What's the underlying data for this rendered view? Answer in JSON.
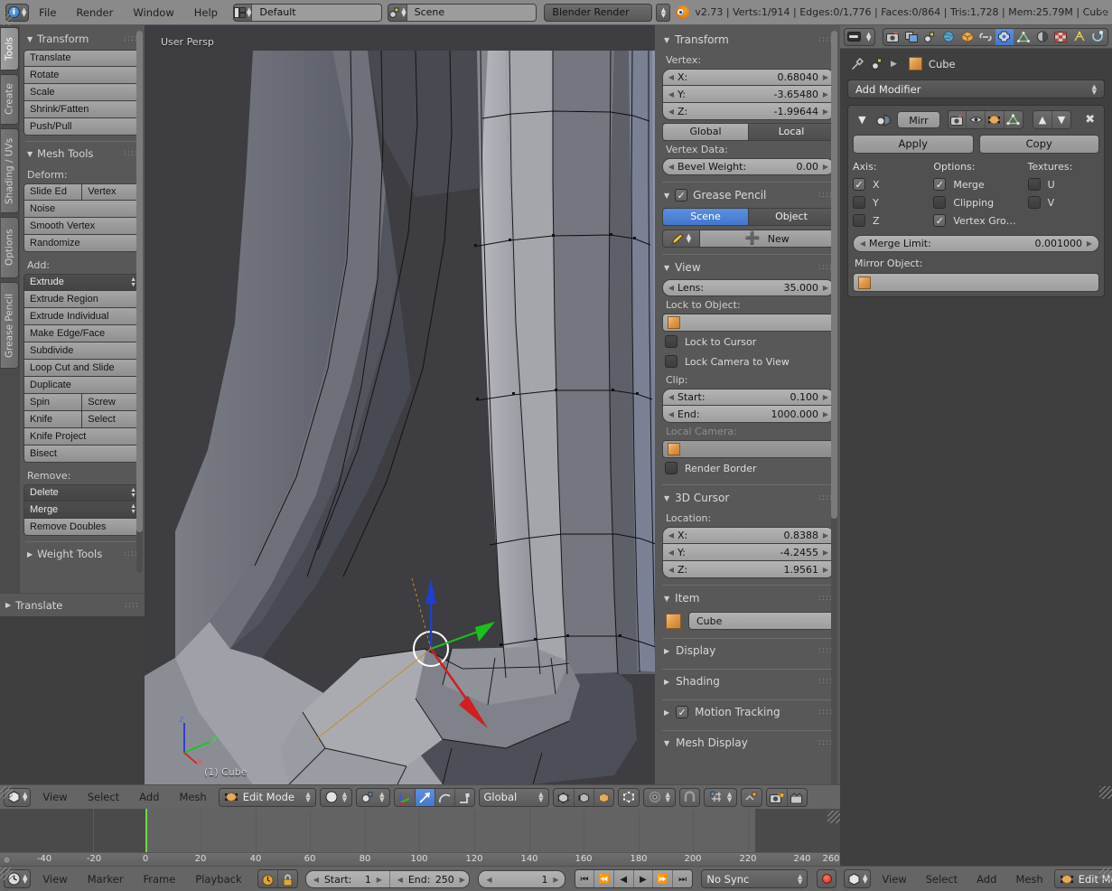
{
  "topbar": {
    "menus": [
      "File",
      "Render",
      "Window",
      "Help"
    ],
    "layout_value": "Default",
    "scene_value": "Scene",
    "engine_value": "Blender Render",
    "stats": "v2.73 | Verts:1/914 | Edges:0/1,776 | Faces:0/864 | Tris:1,728 | Mem:25.79M | Cube",
    "plus_label": "+",
    "x_label": "✕"
  },
  "left_tabs": [
    "Tools",
    "Create",
    "Shading / UVs",
    "Options",
    "Grease Pencil"
  ],
  "toolshelf": {
    "transform_title": "Transform",
    "transform_buttons": [
      "Translate",
      "Rotate",
      "Scale",
      "Shrink/Fatten",
      "Push/Pull"
    ],
    "meshtools_title": "Mesh Tools",
    "deform_label": "Deform:",
    "deform_pair": [
      "Slide Ed",
      "Vertex"
    ],
    "deform_rest": [
      "Noise",
      "Smooth Vertex",
      "Randomize"
    ],
    "add_label": "Add:",
    "add_dropdown": "Extrude",
    "add_buttons": [
      "Extrude Region",
      "Extrude Individual",
      "Make Edge/Face",
      "Subdivide",
      "Loop Cut and Slide",
      "Duplicate"
    ],
    "add_pair1": [
      "Spin",
      "Screw"
    ],
    "add_pair2": [
      "Knife",
      "Select"
    ],
    "add_buttons2": [
      "Knife Project",
      "Bisect"
    ],
    "remove_label": "Remove:",
    "remove_dropdowns": [
      "Delete",
      "Merge"
    ],
    "remove_button": "Remove Doubles",
    "weight_tools_title": "Weight Tools",
    "operator_panel": "Translate"
  },
  "viewport": {
    "view_label": "User Persp",
    "object_label": "(1) Cube",
    "axis_x": "x",
    "axis_y": "y",
    "axis_z": "z"
  },
  "npanel": {
    "transform_title": "Transform",
    "vertex_label": "Vertex:",
    "vertex": [
      {
        "name": "X:",
        "value": "0.68040"
      },
      {
        "name": "Y:",
        "value": "-3.65480"
      },
      {
        "name": "Z:",
        "value": "-1.99644"
      }
    ],
    "global_label": "Global",
    "local_label": "Local",
    "vertex_data_label": "Vertex Data:",
    "bevel_weight": {
      "name": "Bevel Weight:",
      "value": "0.00"
    },
    "grease_pencil_title": "Grease Pencil",
    "gp_scene": "Scene",
    "gp_object": "Object",
    "gp_new": "New",
    "view_title": "View",
    "lens": {
      "name": "Lens:",
      "value": "35.000"
    },
    "lock_to_object_label": "Lock to Object:",
    "lock_to_cursor": "Lock to Cursor",
    "lock_camera_to_view": "Lock Camera to View",
    "clip_label": "Clip:",
    "clip_start": {
      "name": "Start:",
      "value": "0.100"
    },
    "clip_end": {
      "name": "End:",
      "value": "1000.000"
    },
    "local_camera_label": "Local Camera:",
    "render_border": "Render Border",
    "cursor_title": "3D Cursor",
    "location_label": "Location:",
    "cursor": [
      {
        "name": "X:",
        "value": "0.8388"
      },
      {
        "name": "Y:",
        "value": "-4.2455"
      },
      {
        "name": "Z:",
        "value": "1.9561"
      }
    ],
    "item_title": "Item",
    "item_name": "Cube",
    "display_title": "Display",
    "shading_title": "Shading",
    "motion_tracking_title": "Motion Tracking",
    "mesh_display_title": "Mesh Display"
  },
  "properties": {
    "breadcrumb_object": "Cube",
    "add_modifier": "Add Modifier",
    "modifier_name": "Mirr",
    "apply_label": "Apply",
    "copy_label": "Copy",
    "axis_label": "Axis:",
    "options_label": "Options:",
    "textures_label": "Textures:",
    "axis_items": [
      {
        "label": "X",
        "checked": true
      },
      {
        "label": "Y",
        "checked": false
      },
      {
        "label": "Z",
        "checked": false
      }
    ],
    "options_items": [
      {
        "label": "Merge",
        "checked": true
      },
      {
        "label": "Clipping",
        "checked": false
      },
      {
        "label": "Vertex Gro…",
        "checked": true
      }
    ],
    "textures_items": [
      {
        "label": "U",
        "checked": false
      },
      {
        "label": "V",
        "checked": false
      }
    ],
    "merge_limit": {
      "name": "Merge Limit:",
      "value": "0.001000"
    },
    "mirror_object_label": "Mirror Object:",
    "tabs": [
      "render-icon",
      "render-layers-icon",
      "scene-icon",
      "world-icon",
      "object-icon",
      "constraints-icon",
      "modifiers-icon",
      "data-icon",
      "material-icon",
      "texture-icon",
      "particles-icon",
      "physics-icon"
    ]
  },
  "vp_header": {
    "menus": [
      "View",
      "Select",
      "Add",
      "Mesh"
    ],
    "mode": "Edit Mode",
    "orientation": "Global"
  },
  "timeline": {
    "ticks": [
      -40,
      -20,
      0,
      20,
      40,
      60,
      80,
      100,
      120,
      140,
      160,
      180,
      200,
      220,
      240,
      260
    ],
    "playhead_frame": 1,
    "range_start": 0,
    "range_end": 250
  },
  "tl_header": {
    "menus": [
      "View",
      "Marker",
      "Frame",
      "Playback"
    ],
    "start": {
      "name": "Start:",
      "value": "1"
    },
    "end": {
      "name": "End:",
      "value": "250"
    },
    "current_frame": "1",
    "sync_mode": "No Sync"
  },
  "props_footer": {
    "menus": [
      "View",
      "Select",
      "Add",
      "Mesh"
    ],
    "mode": "Edit Mode"
  },
  "colors": {
    "accent_blue": "#4377cc",
    "viewport_bg": "#3d3d42",
    "panel_bg": "#585858",
    "header_bg": "#656565",
    "playhead_green": "#6ddb42",
    "cube_orange": "#e09a4e"
  }
}
